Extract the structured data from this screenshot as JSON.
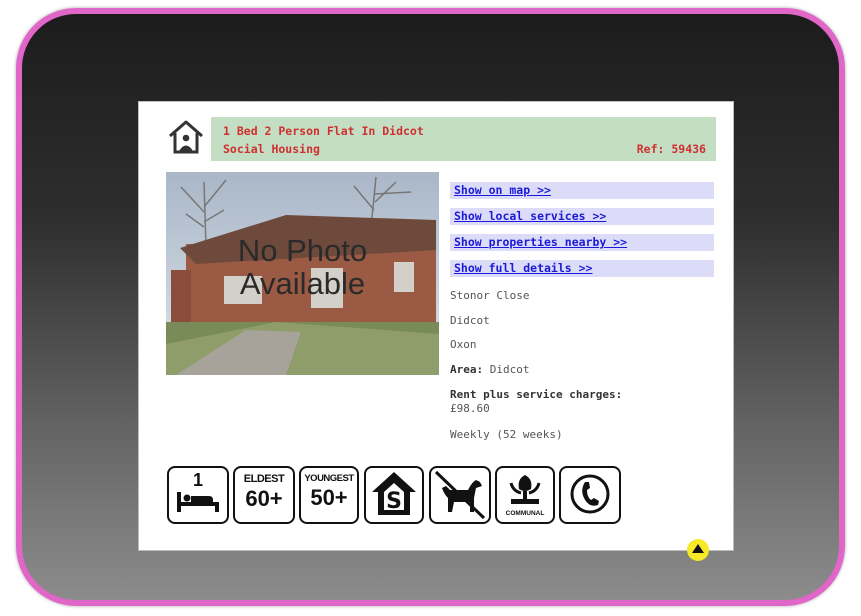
{
  "listing": {
    "title": "1 Bed 2 Person Flat In Didcot",
    "tenure": "Social Housing",
    "ref": "Ref: 59436",
    "photo_text_line1": "No Photo",
    "photo_text_line2": "Available"
  },
  "links": {
    "map": "Show on map >>",
    "services": "Show local services >>",
    "nearby": "Show properties nearby >>",
    "details": "Show full details >>"
  },
  "address": {
    "line1": "Stonor Close",
    "line2": "Didcot",
    "line3": "Oxon",
    "area_label": "Area:",
    "area_value": " Didcot"
  },
  "rent": {
    "label": "Rent plus service charges:",
    "amount": "£98.60",
    "period": "Weekly (52 weeks)"
  },
  "features": {
    "bedrooms": "1",
    "eldest_label": "ELDEST",
    "eldest_value": "60+",
    "youngest_label": "YOUNGEST",
    "youngest_value": "50+",
    "communal_label": "COMMUNAL"
  },
  "colors": {
    "frame_border": "#e066c8",
    "title_bg": "#c3dec3",
    "title_text": "#d03030",
    "link_bg": "#dcdcf9",
    "link_text": "#1a1ad8"
  },
  "icons": [
    "home-icon",
    "bed-icon",
    "eldest-age-icon",
    "youngest-age-icon",
    "sheltered-housing-icon",
    "no-pets-icon",
    "communal-garden-icon",
    "telephone-icon"
  ]
}
